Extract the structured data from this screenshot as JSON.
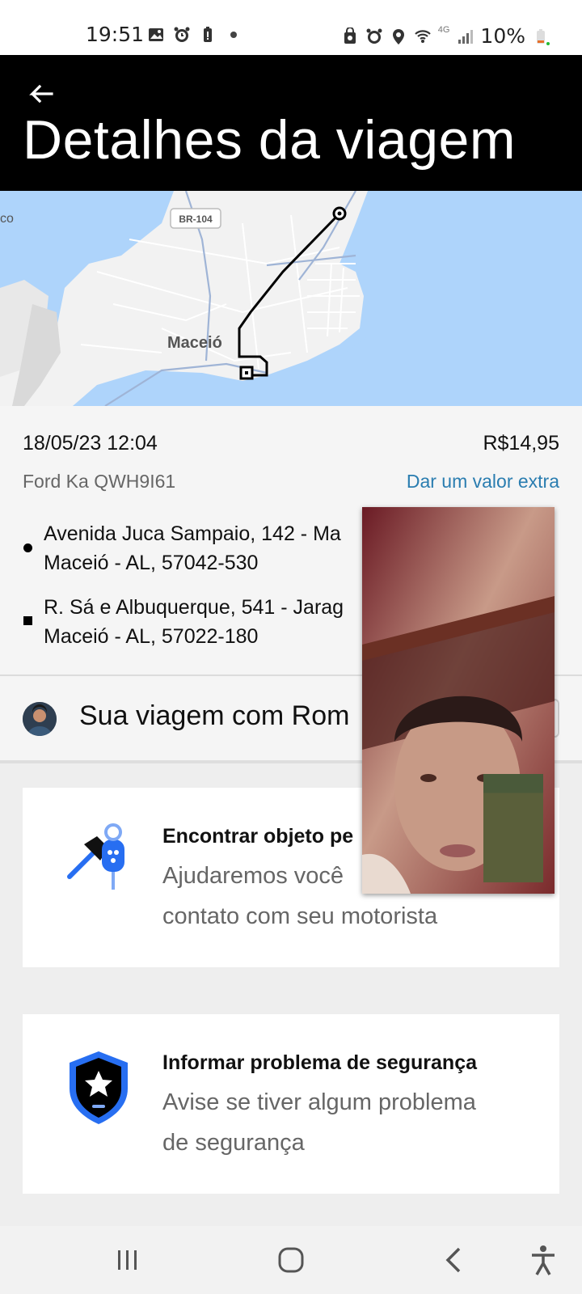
{
  "status_bar": {
    "time": "19:51",
    "battery": "10%",
    "network": "4G"
  },
  "header": {
    "title": "Detalhes da viagem"
  },
  "map": {
    "road_badge": "BR-104",
    "city_label": "Maceió",
    "edge_label": "co"
  },
  "trip": {
    "datetime": "18/05/23 12:04",
    "price": "R$14,95",
    "vehicle": "Ford Ka QWH9I61",
    "tip_link": "Dar um valor extra",
    "pickup_line1": "Avenida Juca Sampaio, 142 - Ma",
    "pickup_line2": "Maceió - AL, 57042-530",
    "dropoff_line1": "R. Sá e Albuquerque, 541 - Jarag",
    "dropoff_line2": "Maceió - AL, 57022-180"
  },
  "driver": {
    "text": "Sua viagem com Rom"
  },
  "cards": [
    {
      "title": "Encontrar objeto pe",
      "subtitle": "Ajudaremos você",
      "subtitle2": "contato com seu motorista",
      "icon": "keys-icon"
    },
    {
      "title": "Informar problema de segurança",
      "subtitle": "Avise se tiver algum problema",
      "subtitle2": "de segurança",
      "icon": "shield-star-icon"
    }
  ],
  "colors": {
    "header_bg": "#000000",
    "link": "#2a7db0",
    "accent_blue": "#276ef1",
    "map_water": "#aed4fb"
  }
}
